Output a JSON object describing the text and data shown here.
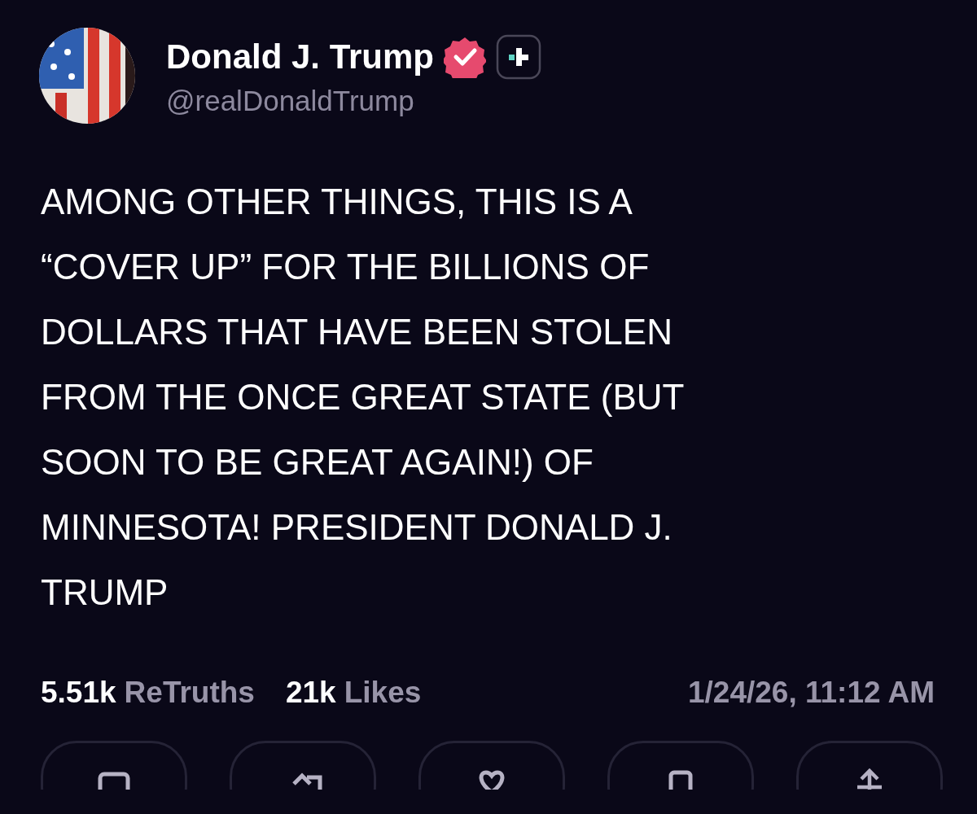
{
  "author": {
    "name": "Donald J. Trump",
    "verified": true,
    "handle": "@realDonaldTrump"
  },
  "post": {
    "text": "AMONG OTHER THINGS, THIS IS A\n“COVER UP” FOR THE BILLIONS OF\nDOLLARS THAT HAVE BEEN STOLEN\nFROM THE ONCE GREAT STATE (BUT\nSOON TO BE GREAT AGAIN!) OF\nMINNESOTA! PRESIDENT DONALD J.\nTRUMP"
  },
  "stats": [
    {
      "count": "5.51k",
      "label": "ReTruths"
    },
    {
      "count": "21k",
      "label": "Likes"
    }
  ],
  "timestamp": "1/24/26, 11:12 AM",
  "actions": [
    {
      "kind": "reply"
    },
    {
      "kind": "retruth"
    },
    {
      "kind": "like"
    },
    {
      "kind": "bookmark"
    },
    {
      "kind": "share"
    }
  ]
}
